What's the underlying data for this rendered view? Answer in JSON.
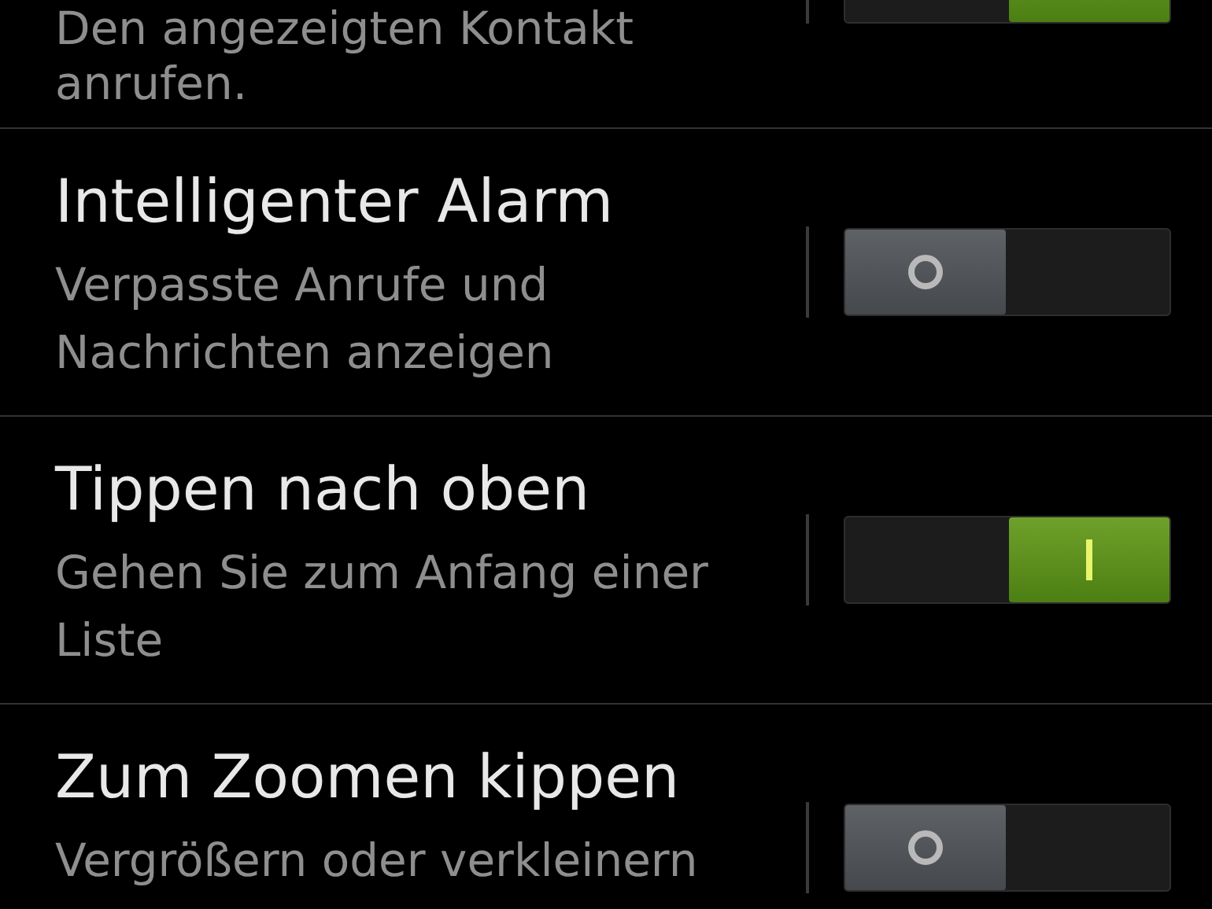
{
  "settings": [
    {
      "description": "Den angezeigten Kontakt anrufen.",
      "on": true
    },
    {
      "title": "Intelligenter Alarm",
      "description": "Verpasste Anrufe und Nachrichten anzeigen",
      "on": false
    },
    {
      "title": "Tippen nach oben",
      "description": "Gehen Sie zum Anfang einer Liste",
      "on": true
    },
    {
      "title": "Zum Zoomen kippen",
      "description": "Vergrößern oder verkleinern",
      "on": false
    }
  ]
}
